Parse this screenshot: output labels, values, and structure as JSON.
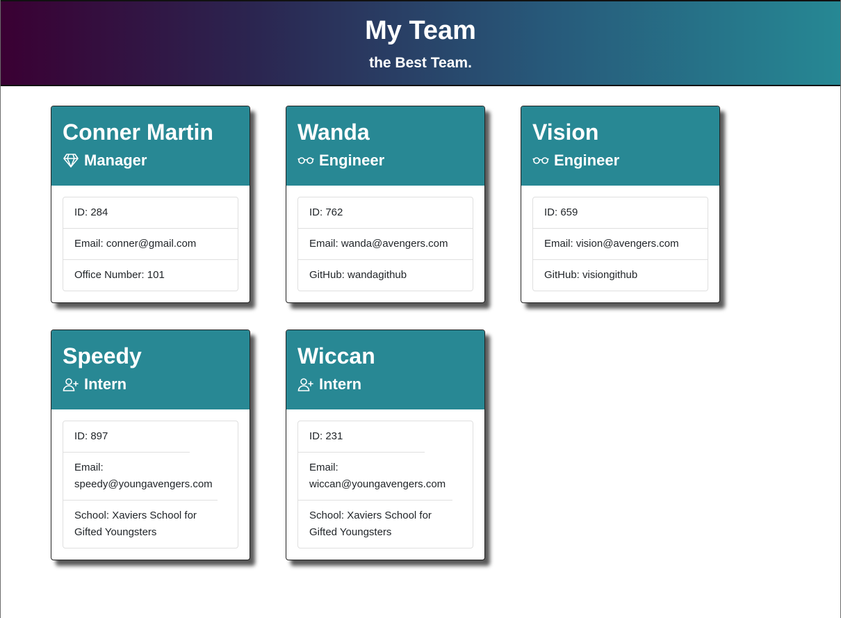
{
  "header": {
    "title": "My Team",
    "subtitle": "the Best Team."
  },
  "team": [
    {
      "name": "Conner Martin",
      "role": "Manager",
      "icon": "gem-icon",
      "id_text": "ID: 284",
      "email_text": "Email: conner@gmail.com",
      "extra_text": "Office Number: 101"
    },
    {
      "name": "Wanda",
      "role": "Engineer",
      "icon": "glasses-icon",
      "id_text": "ID: 762",
      "email_text": "Email: wanda@avengers.com",
      "extra_text": "GitHub: wandagithub"
    },
    {
      "name": "Vision",
      "role": "Engineer",
      "icon": "glasses-icon",
      "id_text": "ID: 659",
      "email_text": "Email: vision@avengers.com",
      "extra_text": "GitHub: visiongithub"
    },
    {
      "name": "Speedy",
      "role": "Intern",
      "icon": "user-plus-icon",
      "id_text": "ID: 897",
      "email_text": "Email: speedy@youngavengers.com",
      "extra_text": "School: Xaviers School for Gifted Youngsters"
    },
    {
      "name": "Wiccan",
      "role": "Intern",
      "icon": "user-plus-icon",
      "id_text": "ID: 231",
      "email_text": "Email: wiccan@youngavengers.com",
      "extra_text": "School: Xaviers School for Gifted Youngsters"
    }
  ],
  "colors": {
    "card_header": "#288894",
    "banner_start": "#3a0033",
    "banner_end": "#268894"
  }
}
